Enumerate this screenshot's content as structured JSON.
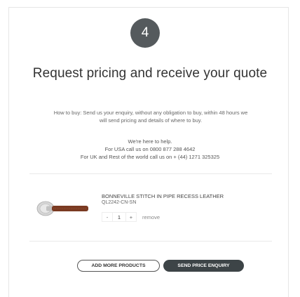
{
  "step": {
    "number": "4"
  },
  "heading": "Request pricing and receive your quote",
  "howto": {
    "line1": "How to buy: Send us your enquiry, without any obligation to buy, within 48 hours we",
    "line2": "will send pricing and details of where to buy."
  },
  "contact": {
    "line1": "We're here to help.",
    "line2": "For USA call us on 0800 877 288 4642",
    "line3": "For UK and Rest of the world call us on + (44) 1271 325325"
  },
  "product": {
    "name": "BONNEVILLE STITCH IN PIPE RECESS LEATHER",
    "code": "QL2242-CN-SN",
    "decrement": "-",
    "quantity": "1",
    "increment": "+",
    "remove": "remove"
  },
  "buttons": {
    "add_more": "ADD MORE PRODUCTS",
    "send": "SEND PRICE ENQUIRY"
  },
  "colors": {
    "circle": "#555a5d",
    "send_button": "#3d4447",
    "leather": "#7a3a22",
    "metal": "#c9c9c9"
  }
}
